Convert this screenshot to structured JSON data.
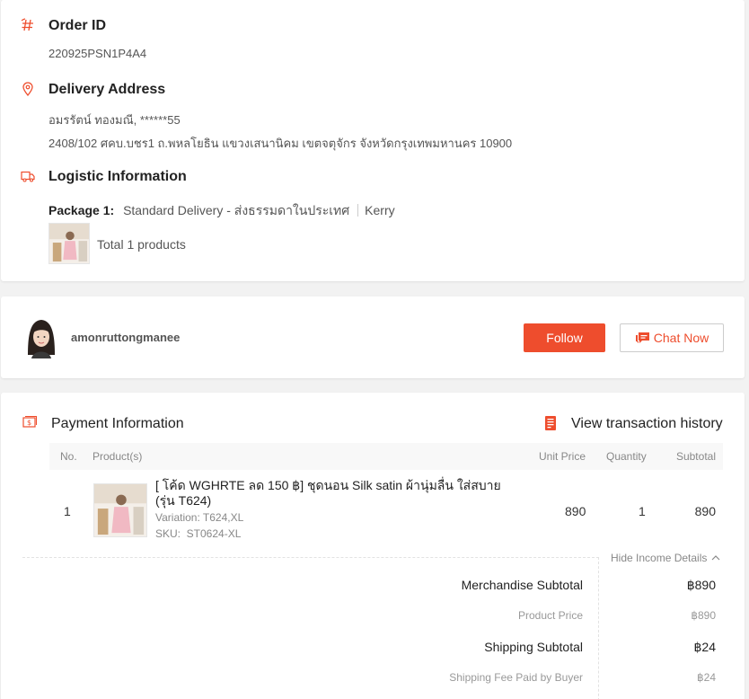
{
  "order": {
    "title": "Order ID",
    "id": "220925PSN1P4A4"
  },
  "delivery": {
    "title": "Delivery Address",
    "name_line": "อมรรัตน์ ทองมณี, ******55",
    "address_line": "2408/102 ศคบ.บชร1 ถ.พหลโยธิน แขวงเสนานิคม เขตจตุจักร จังหวัดกรุงเทพมหานคร 10900"
  },
  "logistic": {
    "title": "Logistic Information",
    "package_label": "Package 1:",
    "service": "Standard Delivery - ส่งธรรมดาในประเทศ",
    "carrier": "Kerry",
    "total_products": "Total 1 products"
  },
  "shop": {
    "name": "amonruttongmanee",
    "follow_label": "Follow",
    "chat_label": "Chat Now"
  },
  "payment": {
    "title": "Payment Information",
    "history_link": "View transaction history",
    "columns": {
      "no": "No.",
      "products": "Product(s)",
      "unit_price": "Unit Price",
      "quantity": "Quantity",
      "subtotal": "Subtotal"
    },
    "items": [
      {
        "no": "1",
        "name": "[ โค้ด WGHRTE ลด 150 ฿] ชุดนอน Silk satin ผ้านุ่มลื่น ใส่สบาย (รุ่น T624)",
        "variation": "Variation: T624,XL",
        "sku": "SKU:  ST0624-XL",
        "unit_price": "890",
        "quantity": "1",
        "subtotal": "890"
      }
    ],
    "hide_details": "Hide Income Details",
    "income": [
      {
        "label": "Merchandise Subtotal",
        "value": "฿890"
      },
      {
        "label": "Product Price",
        "value": "฿890"
      },
      {
        "label": "Shipping Subtotal",
        "value": "฿24"
      },
      {
        "label": "Shipping Fee Paid by Buyer",
        "value": "฿24"
      }
    ]
  },
  "colors": {
    "accent": "#ee4d2d",
    "background": "#f2f2f2"
  },
  "icons": {
    "order": "hash-icon",
    "delivery": "location-pin-icon",
    "logistic": "truck-icon",
    "payment": "money-icon",
    "history": "document-icon"
  }
}
